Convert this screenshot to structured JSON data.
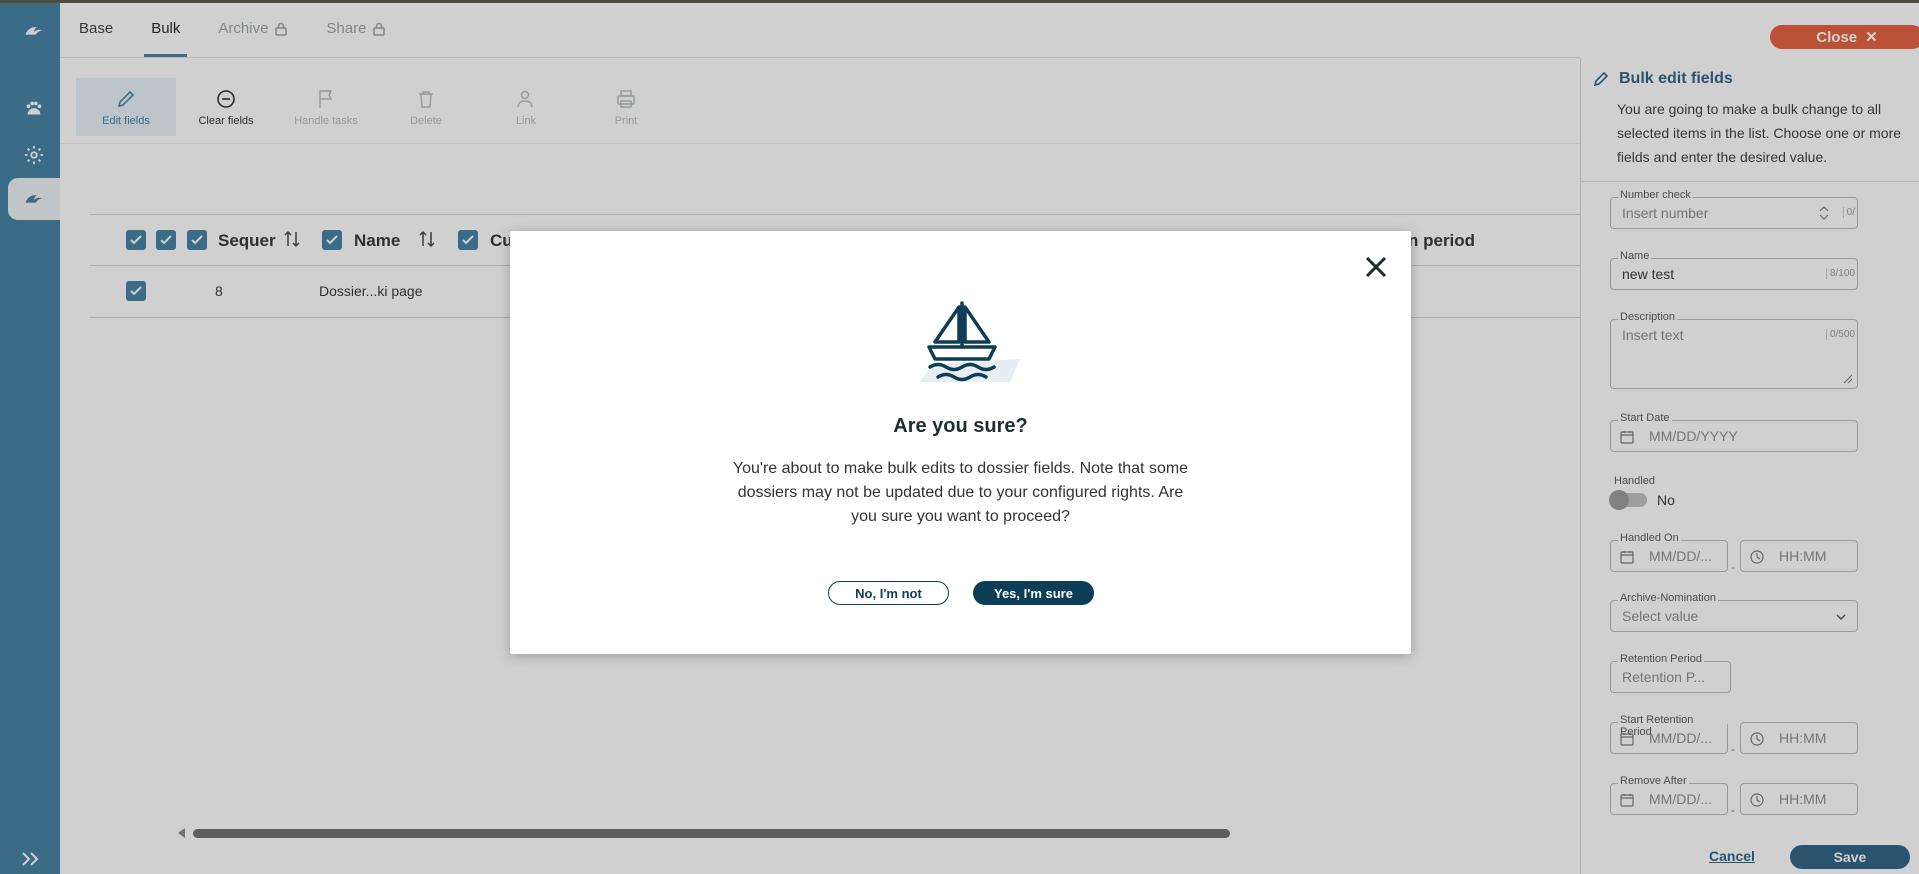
{
  "tabs": [
    {
      "label": "Base"
    },
    {
      "label": "Bulk"
    },
    {
      "label": "Archive"
    },
    {
      "label": "Share"
    }
  ],
  "close_button": {
    "label": "Close"
  },
  "toolbar": [
    {
      "label": "Edit fields",
      "icon": "pencil-icon"
    },
    {
      "label": "Clear fields",
      "icon": "minus-circle-icon"
    },
    {
      "label": "Handle tasks",
      "icon": "flag-icon"
    },
    {
      "label": "Delete",
      "icon": "trash-icon"
    },
    {
      "label": "Link",
      "icon": "link-user-icon"
    },
    {
      "label": "Print",
      "icon": "printer-icon"
    }
  ],
  "table": {
    "headers": [
      "Sequer",
      "Name",
      "Cu",
      "n period"
    ],
    "rows": [
      {
        "sequence": "8",
        "name": "Dossier...ki page"
      }
    ]
  },
  "panel": {
    "title": "Bulk edit fields",
    "description": "You are going to make a bulk change to all selected items in the list. Choose one or more fields and enter the desired value.",
    "fields": {
      "number_check": {
        "label": "Number check",
        "placeholder": "Insert number",
        "counter": "0/"
      },
      "name": {
        "label": "Name",
        "value": "new test",
        "counter": "8/100"
      },
      "description": {
        "label": "Description",
        "placeholder": "Insert text",
        "counter": "0/500"
      },
      "start_date": {
        "label": "Start Date",
        "placeholder": "MM/DD/YYYY"
      },
      "handled": {
        "label": "Handled",
        "value": "No"
      },
      "handled_on": {
        "label": "Handled On",
        "date_placeholder": "MM/DD/...",
        "time_placeholder": "HH:MM"
      },
      "archive_nomination": {
        "label": "Archive-Nomination",
        "placeholder": "Select value"
      },
      "retention_period": {
        "label": "Retention Period",
        "placeholder": "Retention P..."
      },
      "start_retention_period": {
        "label": "Start Retention Period",
        "date_placeholder": "MM/DD/...",
        "time_placeholder": "HH:MM"
      },
      "remove_after": {
        "label": "Remove After",
        "date_placeholder": "MM/DD/...",
        "time_placeholder": "HH:MM"
      }
    },
    "cancel_label": "Cancel",
    "save_label": "Save"
  },
  "modal": {
    "title": "Are you sure?",
    "body": "You're about to make bulk edits to dossier fields. Note that some dossiers may not be updated due to your configured rights. Are you sure you want to proceed?",
    "no_label": "No, I'm not",
    "yes_label": "Yes, I'm sure"
  },
  "colors": {
    "rail": "#3f7fa3",
    "primary_dark": "#0d3d57",
    "close_accent": "#e45d3a"
  }
}
